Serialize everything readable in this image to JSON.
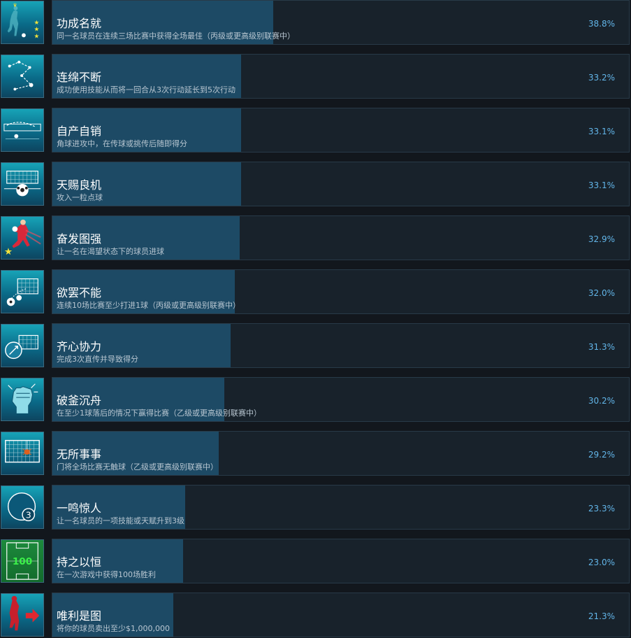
{
  "achievements": [
    {
      "title": "功成名就",
      "description": "同一名球员在连续三场比赛中获得全场最佳（丙级或更高级别联赛中）",
      "percent": "38.8%",
      "percent_value": 38.8,
      "icon": "star-player-icon"
    },
    {
      "title": "连绵不断",
      "description": "成功使用技能从而将一回合从3次行动延长到5次行动",
      "percent": "33.2%",
      "percent_value": 33.2,
      "icon": "chain-moves-icon"
    },
    {
      "title": "自产自销",
      "description": "角球进攻中，在传球或挑传后随即得分",
      "percent": "33.1%",
      "percent_value": 33.1,
      "icon": "corner-kick-icon"
    },
    {
      "title": "天赐良机",
      "description": "攻入一粒点球",
      "percent": "33.1%",
      "percent_value": 33.1,
      "icon": "penalty-ball-icon"
    },
    {
      "title": "奋发图强",
      "description": "让一名在渴望状态下的球员进球",
      "percent": "32.9%",
      "percent_value": 32.9,
      "icon": "striker-star-icon"
    },
    {
      "title": "欲罢不能",
      "description": "连续10场比赛至少打进1球（丙级或更高级别联赛中）",
      "percent": "32.0%",
      "percent_value": 32.0,
      "icon": "goal-balls-icon"
    },
    {
      "title": "齐心协力",
      "description": "完成3次直传并导致得分",
      "percent": "31.3%",
      "percent_value": 31.3,
      "icon": "through-pass-icon"
    },
    {
      "title": "破釜沉舟",
      "description": "在至少1球落后的情况下赢得比赛（乙级或更高级别联赛中）",
      "percent": "30.2%",
      "percent_value": 30.2,
      "icon": "fist-icon"
    },
    {
      "title": "无所事事",
      "description": "门将全场比赛无触球（乙级或更高级别联赛中）",
      "percent": "29.2%",
      "percent_value": 29.2,
      "icon": "spider-net-icon"
    },
    {
      "title": "一鸣惊人",
      "description": "让一名球员的一项技能或天赋升到3级",
      "percent": "23.3%",
      "percent_value": 23.3,
      "icon": "level-three-icon"
    },
    {
      "title": "持之以恒",
      "description": "在一次游戏中获得100场胜利",
      "percent": "23.0%",
      "percent_value": 23.0,
      "icon": "hundred-wins-icon",
      "icon_text": "100"
    },
    {
      "title": "唯利是图",
      "description": "将你的球员卖出至少$1,000,000",
      "percent": "21.3%",
      "percent_value": 21.3,
      "icon": "sell-player-icon"
    }
  ],
  "icon_badge_text": "3",
  "colors": {
    "page_background": "#12171d",
    "panel_background": "#18222b",
    "progress_fill": "#1d4a65",
    "percent_text": "#62b5e8"
  }
}
